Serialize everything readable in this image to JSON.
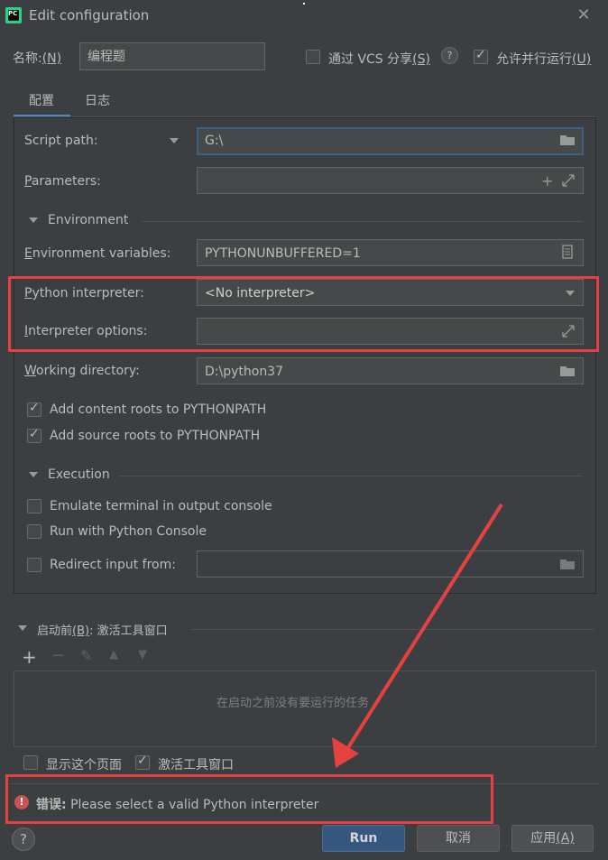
{
  "window": {
    "title": "Edit configuration",
    "close_glyph": "✕",
    "app_icon_text": "PC"
  },
  "header": {
    "name_label": "名称:",
    "name_mnemonic": "(N)",
    "name_value": "编程题",
    "vcs_share_label": "通过 VCS 分享",
    "vcs_share_mnemonic": "(S)",
    "vcs_share_checked": false,
    "help_glyph": "?",
    "parallel_label": "允许并行运行",
    "parallel_mnemonic": "(U)",
    "parallel_checked": true
  },
  "tabs": [
    {
      "label": "配置",
      "active": true
    },
    {
      "label": "日志",
      "active": false
    }
  ],
  "config": {
    "script_path_label": "Script path:",
    "script_path_value": "G:\\",
    "parameters_label": "Parameters:",
    "parameters_value": "",
    "environment_section": "Environment",
    "env_vars_label": "Environment variables:",
    "env_vars_value": "PYTHONUNBUFFERED=1",
    "interpreter_label": "Python interpreter:",
    "interpreter_value": "<No interpreter>",
    "interpreter_options_label": "Interpreter options:",
    "interpreter_options_value": "",
    "working_dir_label": "Working directory:",
    "working_dir_value": "D:\\python37",
    "add_content_roots_label": "Add content roots to PYTHONPATH",
    "add_content_roots_checked": true,
    "add_source_roots_label": "Add source roots to PYTHONPATH",
    "add_source_roots_checked": true,
    "execution_section": "Execution",
    "emulate_terminal_label": "Emulate terminal in output console",
    "emulate_terminal_checked": false,
    "run_with_console_label": "Run with Python Console",
    "run_with_console_checked": false,
    "redirect_input_label": "Redirect input from:",
    "redirect_input_checked": false,
    "redirect_input_value": ""
  },
  "before_launch": {
    "title": "启动前",
    "mnemonic": "(B)",
    "suffix": ": 激活工具窗口",
    "empty_text": "在启动之前没有要运行的任务",
    "toolbar": [
      "+",
      "−",
      "✎",
      "▲",
      "▼"
    ]
  },
  "footer_options": {
    "show_page_label": "显示这个页面",
    "show_page_checked": false,
    "activate_tool_window_label": "激活工具窗口",
    "activate_tool_window_checked": true
  },
  "error": {
    "prefix": "错误:",
    "message": "Please select a valid Python interpreter"
  },
  "buttons": {
    "help": "?",
    "run": "Run",
    "cancel": "取消",
    "apply": "应用",
    "apply_mnemonic": "(A)"
  },
  "colors": {
    "background": "#3c3f41",
    "field": "#45494a",
    "focus_border": "#3d6185",
    "primary_button": "#365880",
    "annotation_red": "#e64141",
    "error_icon": "#c75450",
    "tab_underline": "#4a88c7"
  },
  "icons": {
    "folder": "folder-icon",
    "plus": "plus-icon",
    "expand": "expand-icon",
    "document": "document-icon",
    "dropdown": "dropdown-arrow-icon",
    "error": "error-icon",
    "help": "help-icon"
  }
}
